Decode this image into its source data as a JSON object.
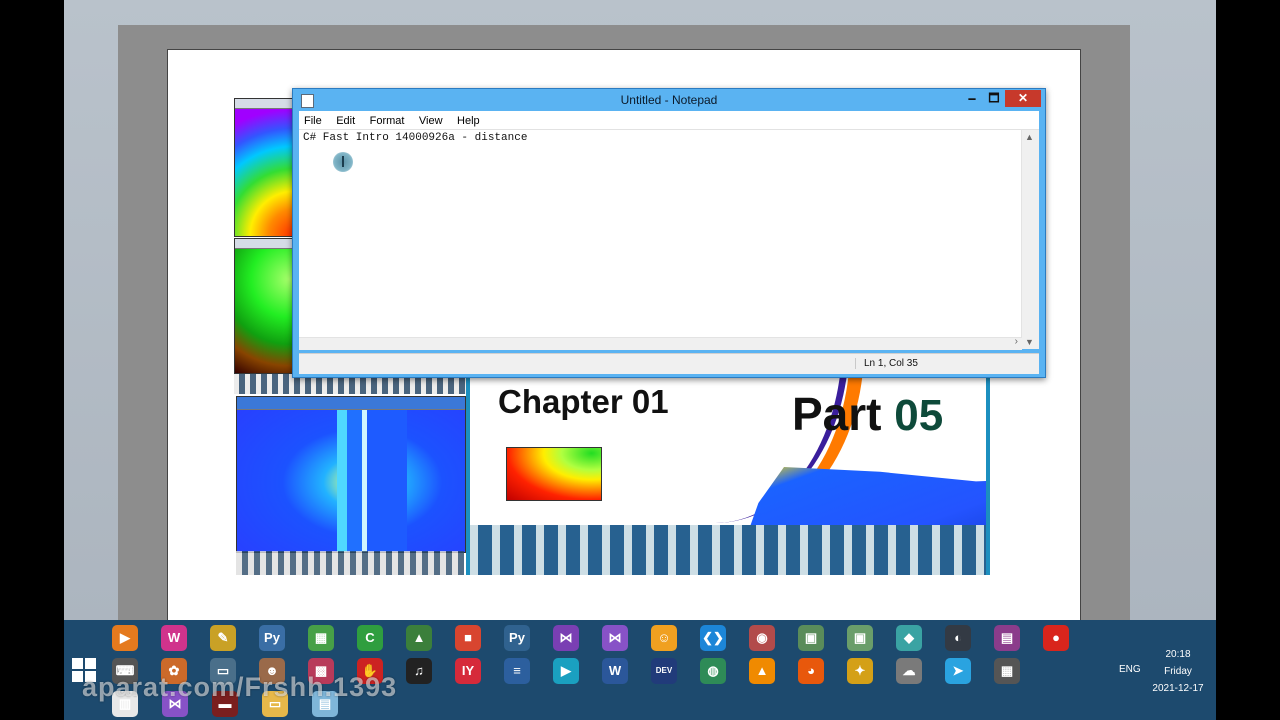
{
  "notepad": {
    "title": "Untitled - Notepad",
    "min_label": "🗕",
    "max_label": "🗖",
    "close_label": "✕",
    "menu": [
      "File",
      "Edit",
      "Format",
      "View",
      "Help"
    ],
    "content": "C# Fast Intro 14000926a - distance",
    "status_position": "Ln 1, Col 35"
  },
  "slide": {
    "chapter_title": "Chapter 01",
    "part_label": "Part",
    "part_number": "05"
  },
  "taskbar": {
    "clock_time": "20:18",
    "clock_day": "Friday",
    "clock_date": "2021-12-17",
    "language": "ENG",
    "row1_icons": [
      {
        "name": "media-player-icon",
        "glyph": "▶",
        "color": "#e57a1e"
      },
      {
        "name": "wamp-icon",
        "glyph": "W",
        "color": "#d0338c"
      },
      {
        "name": "tools-icon",
        "glyph": "✎",
        "color": "#c9a126"
      },
      {
        "name": "python-file-icon",
        "glyph": "Py",
        "color": "#3a6ea5"
      },
      {
        "name": "spreadsheet-icon",
        "glyph": "▦",
        "color": "#47a047"
      },
      {
        "name": "camtasia-icon",
        "glyph": "C",
        "color": "#2f9e3f"
      },
      {
        "name": "chart-app-icon",
        "glyph": "▲",
        "color": "#3b7f3b"
      },
      {
        "name": "office-icon",
        "glyph": "■",
        "color": "#d8452f"
      },
      {
        "name": "python-icon",
        "glyph": "Py",
        "color": "#30628f"
      },
      {
        "name": "visual-studio-installer-icon",
        "glyph": "⋈",
        "color": "#7a3fb3"
      },
      {
        "name": "visual-studio-icon",
        "glyph": "⋈",
        "color": "#8752c7"
      },
      {
        "name": "scratch-icon",
        "glyph": "☺",
        "color": "#f0a020"
      },
      {
        "name": "vscode-icon",
        "glyph": "❮❯",
        "color": "#1c86d8"
      },
      {
        "name": "globe-tool-icon",
        "glyph": "◉",
        "color": "#b24b4b"
      },
      {
        "name": "window-app-icon",
        "glyph": "▣",
        "color": "#5a8c5a"
      },
      {
        "name": "window-app-2-icon",
        "glyph": "▣",
        "color": "#6a9e6a"
      },
      {
        "name": "cubes-icon",
        "glyph": "◆",
        "color": "#3aa3a3"
      },
      {
        "name": "eclipse-like-icon",
        "glyph": "◐",
        "color": "#333a44"
      },
      {
        "name": "winrar-icon",
        "glyph": "▤",
        "color": "#8b3c8b"
      },
      {
        "name": "record-icon",
        "glyph": "●",
        "color": "#d9251c"
      }
    ],
    "row2_icons": [
      {
        "name": "keyboard-icon",
        "glyph": "⌨",
        "color": "#555"
      },
      {
        "name": "paint-icon",
        "glyph": "✿",
        "color": "#cc6a2a"
      },
      {
        "name": "monitor-app-icon",
        "glyph": "▭",
        "color": "#4a6f8a"
      },
      {
        "name": "gnu-icon",
        "glyph": "☻",
        "color": "#9a6a4a"
      },
      {
        "name": "checker-icon",
        "glyph": "▩",
        "color": "#b83a5a"
      },
      {
        "name": "stop-icon",
        "glyph": "✋",
        "color": "#c22"
      },
      {
        "name": "piano-icon",
        "glyph": "♫",
        "color": "#222"
      },
      {
        "name": "iy-icon",
        "glyph": "IY",
        "color": "#d62a3a"
      },
      {
        "name": "document-icon",
        "glyph": "≡",
        "color": "#2c5f9e"
      },
      {
        "name": "player-icon",
        "glyph": "▶",
        "color": "#1aa0c0"
      },
      {
        "name": "word-icon",
        "glyph": "W",
        "color": "#2b579a"
      },
      {
        "name": "dev-cpp-icon",
        "glyph": "DEV",
        "color": "#213b7a"
      },
      {
        "name": "network-icon",
        "glyph": "◍",
        "color": "#2e8b57"
      },
      {
        "name": "vlc-icon",
        "glyph": "▲",
        "color": "#f08a00"
      },
      {
        "name": "firefox-icon",
        "glyph": "◕",
        "color": "#e8580c"
      },
      {
        "name": "sticky-notes-icon",
        "glyph": "✦",
        "color": "#d4a017"
      },
      {
        "name": "brain-icon",
        "glyph": "☁",
        "color": "#7a7a7a"
      },
      {
        "name": "telegram-icon",
        "glyph": "➤",
        "color": "#2aa3e0"
      },
      {
        "name": "calculator-icon",
        "glyph": "▦",
        "color": "#555"
      }
    ],
    "row3_icons": [
      {
        "name": "pinned-app-icon",
        "glyph": "▥",
        "color": "#e8e8e8"
      },
      {
        "name": "visual-studio-pinned-icon",
        "glyph": "⋈",
        "color": "#8752c7"
      },
      {
        "name": "video-app-icon",
        "glyph": "▬",
        "color": "#7a1f1f"
      },
      {
        "name": "file-explorer-icon",
        "glyph": "▭",
        "color": "#e6b84a"
      },
      {
        "name": "notepad-pinned-icon",
        "glyph": "▤",
        "color": "#7fb6d9"
      }
    ]
  },
  "watermark": "aparat.com/Frshh.1393"
}
